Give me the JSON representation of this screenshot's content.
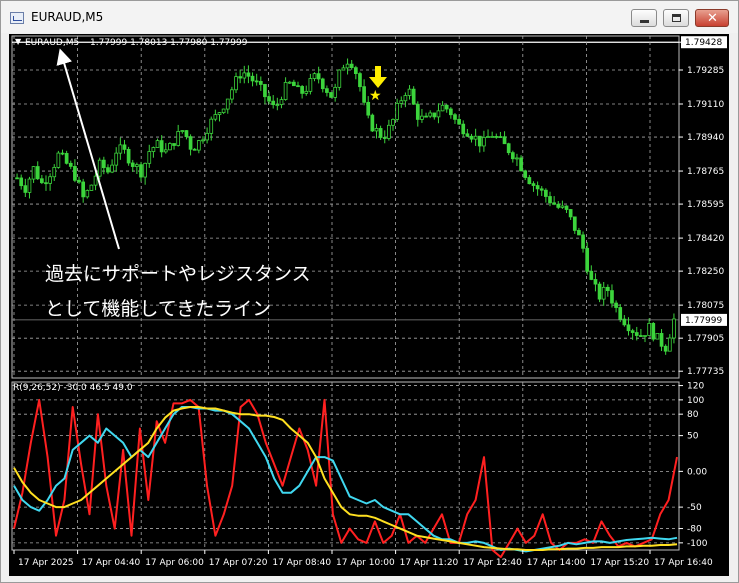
{
  "window": {
    "title": "EURAUD,M5"
  },
  "chart_data": [
    {
      "type": "candlestick",
      "symbol": "EURAUD,M5",
      "ohlc_header": "1.77999 1.78013 1.77980 1.77999",
      "yticks": [
        "1.79428",
        "1.79285",
        "1.79110",
        "1.78940",
        "1.78765",
        "1.78595",
        "1.78420",
        "1.78250",
        "1.78075",
        "1.77905",
        "1.77735"
      ],
      "ylim": [
        1.777,
        1.7946
      ],
      "current_price": "1.77999",
      "xticks": [
        "17 Apr 2025",
        "17 Apr 04:40",
        "17 Apr 06:00",
        "17 Apr 07:20",
        "17 Apr 08:40",
        "17 Apr 10:00",
        "17 Apr 11:20",
        "17 Apr 12:40",
        "17 Apr 14:00",
        "17 Apr 15:20",
        "17 Apr 16:40"
      ],
      "close_series": [
        1.7873,
        1.7868,
        1.7878,
        1.787,
        1.7876,
        1.7885,
        1.788,
        1.7874,
        1.7862,
        1.787,
        1.788,
        1.7876,
        1.7888,
        1.7886,
        1.788,
        1.7876,
        1.7888,
        1.789,
        1.7886,
        1.7893,
        1.7898,
        1.7888,
        1.7892,
        1.79,
        1.7905,
        1.7912,
        1.792,
        1.7928,
        1.7925,
        1.792,
        1.7914,
        1.7908,
        1.7918,
        1.7922,
        1.7916,
        1.792,
        1.7926,
        1.792,
        1.7914,
        1.793,
        1.7935,
        1.7925,
        1.7904,
        1.7898,
        1.7894,
        1.79,
        1.7912,
        1.792,
        1.7906,
        1.7902,
        1.7905,
        1.791,
        1.7908,
        1.79,
        1.7898,
        1.7894,
        1.789,
        1.7896,
        1.7892,
        1.7888,
        1.7884,
        1.7876,
        1.787,
        1.7866,
        1.7862,
        1.7858,
        1.7856,
        1.7848,
        1.7838,
        1.782,
        1.7812,
        1.7816,
        1.7806,
        1.78,
        1.7795,
        1.7792,
        1.7796,
        1.779,
        1.7786,
        1.78
      ],
      "annotations": [
        {
          "type": "text",
          "line1": "過去にサポートやレジスタンス",
          "line2": "として機能してきたライン"
        },
        {
          "type": "marker",
          "label": "★"
        },
        {
          "type": "marker",
          "label": "arrow-down"
        }
      ],
      "colors": {
        "background": "#000000",
        "bull": "#3cd43c",
        "grid": "#bbbbbb",
        "line": "#ffffff"
      }
    },
    {
      "type": "line",
      "indicator_label": "R(9,26,52) -30.0 46.5 49.0",
      "yticks": [
        "120",
        "100",
        "80",
        "50",
        "0.00",
        "-50",
        "-80",
        "-100"
      ],
      "ylim": [
        -110,
        125
      ],
      "series": [
        {
          "color": "#ff2020",
          "values": [
            -80,
            -30,
            40,
            100,
            20,
            -90,
            -40,
            90,
            10,
            -60,
            80,
            -20,
            -80,
            30,
            -90,
            60,
            -40,
            70,
            40,
            95,
            95,
            100,
            90,
            -20,
            -90,
            -60,
            -20,
            90,
            100,
            80,
            40,
            10,
            -20,
            20,
            60,
            30,
            -20,
            100,
            -60,
            -100,
            -80,
            -95,
            -100,
            -70,
            -100,
            -90,
            -60,
            -100,
            -90,
            -100,
            -80,
            -60,
            -100,
            -100,
            -60,
            -40,
            20,
            -110,
            -120,
            -100,
            -80,
            -100,
            -90,
            -60,
            -100,
            -110,
            -100,
            -100,
            -95,
            -100,
            -70,
            -90,
            -105,
            -100,
            -105,
            -100,
            -95,
            -60,
            -40,
            20
          ]
        },
        {
          "color": "#40d8f0",
          "values": [
            -20,
            -40,
            -50,
            -55,
            -40,
            -20,
            -10,
            30,
            40,
            50,
            40,
            60,
            50,
            40,
            20,
            30,
            20,
            40,
            60,
            80,
            90,
            90,
            88,
            88,
            85,
            85,
            80,
            70,
            60,
            40,
            20,
            -10,
            -30,
            -30,
            -20,
            0,
            20,
            20,
            15,
            -10,
            -35,
            -40,
            -45,
            -40,
            -50,
            -55,
            -60,
            -60,
            -70,
            -80,
            -90,
            -95,
            -95,
            -100,
            -100,
            -98,
            -100,
            -105,
            -110,
            -108,
            -110,
            -112,
            -110,
            -108,
            -106,
            -104,
            -100,
            -102,
            -100,
            -98,
            -98,
            -100,
            -98,
            -96,
            -95,
            -94,
            -93,
            -94,
            -95,
            -93
          ]
        },
        {
          "color": "#ffe020",
          "values": [
            5,
            -15,
            -30,
            -40,
            -45,
            -50,
            -50,
            -45,
            -40,
            -30,
            -20,
            -10,
            0,
            10,
            20,
            30,
            40,
            60,
            75,
            85,
            88,
            90,
            90,
            88,
            88,
            85,
            82,
            80,
            80,
            78,
            78,
            76,
            72,
            60,
            50,
            40,
            20,
            -10,
            -30,
            -50,
            -60,
            -62,
            -62,
            -65,
            -70,
            -75,
            -80,
            -85,
            -90,
            -92,
            -94,
            -96,
            -98,
            -100,
            -102,
            -104,
            -106,
            -107,
            -108,
            -109,
            -109,
            -110,
            -110,
            -110,
            -109,
            -109,
            -108,
            -108,
            -107,
            -107,
            -106,
            -106,
            -106,
            -105,
            -105,
            -104,
            -104,
            -103,
            -103,
            -102
          ]
        }
      ],
      "colors": {
        "grid": "#bbbbbb"
      }
    }
  ]
}
